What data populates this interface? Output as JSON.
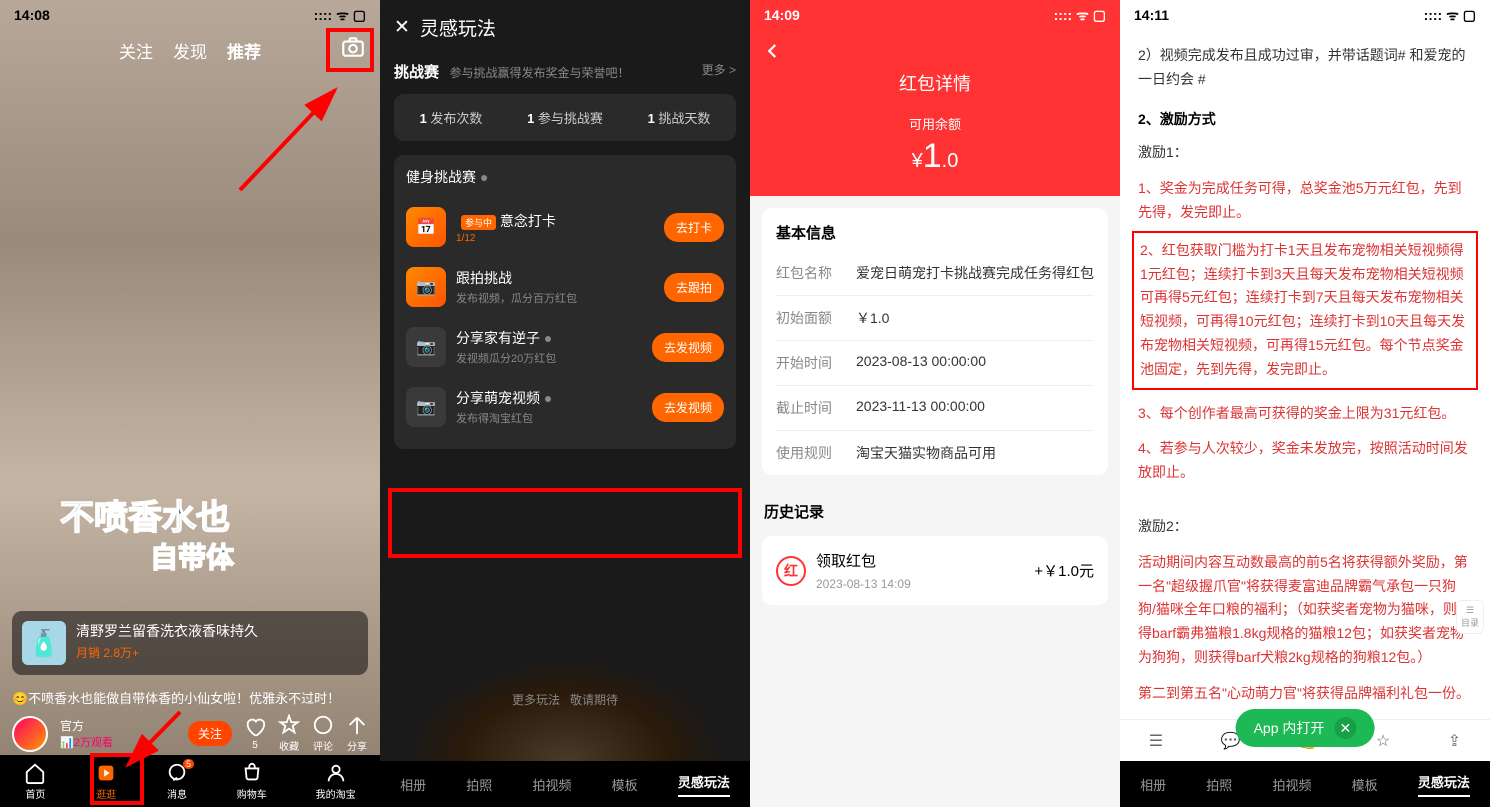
{
  "s1": {
    "time": "14:08",
    "nav": {
      "follow": "关注",
      "discover": "发现",
      "recommend": "推荐"
    },
    "perfume1": "不喷香水也",
    "perfume2": "自带体",
    "product": {
      "title": "清野罗兰留香洗衣液香味持久",
      "sales": "月销 2.8万+"
    },
    "caption": "😊不喷香水也能做自带体香的小仙女啦！优雅永不过时！",
    "user": {
      "name": "官方",
      "views": "📊2万观看",
      "followBtn": "关注"
    },
    "engage": {
      "like": "5",
      "fav": "收藏",
      "comment": "评论",
      "share": "分享"
    },
    "tabs": {
      "home": "首页",
      "browse": "逛逛",
      "msg": "消息",
      "msgBadge": "5",
      "cart": "购物车",
      "my": "我的淘宝"
    }
  },
  "s2": {
    "title": "灵感玩法",
    "challenge": {
      "title": "挑战赛",
      "sub": "参与挑战赢得发布奖金与荣誉吧！",
      "more": "更多 >"
    },
    "stats": {
      "publish": "发布次数",
      "join": "参与挑战赛",
      "days": "挑战天数",
      "n1": "1",
      "n2": "1",
      "n3": "1"
    },
    "fitness": "健身挑战赛",
    "ch1": {
      "title": "意念打卡",
      "tag": "参与中",
      "progress": "1/12",
      "btn": "去打卡"
    },
    "ch2": {
      "title": "跟拍挑战",
      "sub": "发布视频，瓜分百万红包",
      "btn": "去跟拍"
    },
    "ch3": {
      "title": "分享家有逆子",
      "sub": "发视频瓜分20万红包",
      "btn": "去发视频"
    },
    "ch4": {
      "title": "分享萌宠视频",
      "sub": "发布得淘宝红包",
      "btn": "去发视频"
    },
    "moon": {
      "more": "更多玩法",
      "wait": "敬请期待"
    },
    "tabs": {
      "album": "相册",
      "photo": "拍照",
      "video": "拍视频",
      "template": "模板",
      "inspire": "灵感玩法"
    }
  },
  "s3": {
    "time": "14:09",
    "title": "红包详情",
    "balLabel": "可用余额",
    "balCur": "¥",
    "balVal": "1",
    "balDec": ".0",
    "basic": "基本信息",
    "rows": {
      "nameK": "红包名称",
      "nameV": "爱宠日萌宠打卡挑战赛完成任务得红包",
      "amtK": "初始面额",
      "amtV": "￥1.0",
      "startK": "开始时间",
      "startV": "2023-08-13 00:00:00",
      "endK": "截止时间",
      "endV": "2023-11-13 00:00:00",
      "ruleK": "使用规则",
      "ruleV": "淘宝天猫实物商品可用"
    },
    "history": "历史记录",
    "hi": {
      "title": "领取红包",
      "time": "2023-08-13 14:09",
      "amt": "+￥1.0元"
    }
  },
  "s4": {
    "time": "14:11",
    "p0": "2）视频完成发布且成功过审，并带话题词# 和爱宠的一日约会 #",
    "sec1": "2、激励方式",
    "inc1": "激励1：",
    "r1": "1、奖金为完成任务可得，总奖金池5万元红包，先到先得，发完即止。",
    "r2": "2、红包获取门槛为打卡1天且发布宠物相关短视频得1元红包；连续打卡到3天且每天发布宠物相关短视频可再得5元红包；连续打卡到7天且每天发布宠物相关短视频，可再得10元红包；连续打卡到10天且每天发布宠物相关短视频，可再得15元红包。每个节点奖金池固定，先到先得，发完即止。",
    "r3": "3、每个创作者最高可获得的奖金上限为31元红包。",
    "r4": "4、若参与人次较少，奖金未发放完，按照活动时间发放即止。",
    "inc2": "激励2：",
    "r5": "活动期间内容互动数最高的前5名将获得额外奖励，第一名\"超级握爪官\"将获得麦富迪品牌霸气承包一只狗狗/猫咪全年口粮的福利；（如获奖者宠物为猫咪，则获得barf霸弗猫粮1.8kg规格的猫粮12包；如获奖者宠物为狗狗，则获得barf犬粮2kg规格的狗粮12包。）",
    "r6": "第二到第五名\"心动萌力官\"将获得品牌福利礼包一份。",
    "openApp": "App 内打开",
    "toc": "目录",
    "tabs": {
      "album": "相册",
      "photo": "拍照",
      "video": "拍视频",
      "template": "模板",
      "inspire": "灵感玩法"
    }
  }
}
